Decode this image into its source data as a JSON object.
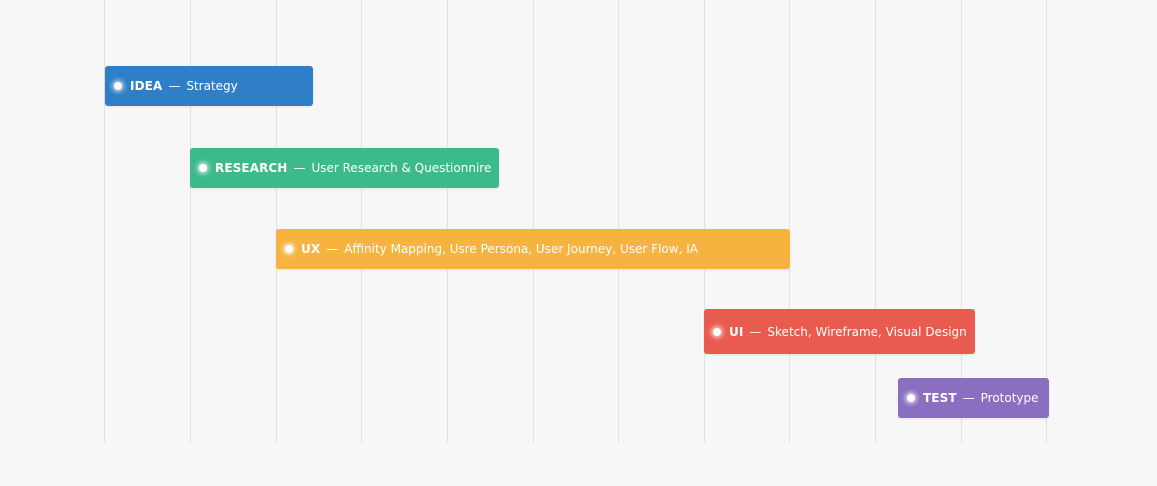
{
  "colors": {
    "background": "#f7f7f7",
    "grid": "#e1e1e1",
    "idea": "#2f7fc8",
    "research": "#3dba8c",
    "ux": "#f6b340",
    "ui": "#e95b4f",
    "test": "#8a6fc0"
  },
  "tasks": [
    {
      "phase": "IDEA",
      "separator": "—",
      "description": "Strategy",
      "color": "#2f7fc8"
    },
    {
      "phase": "RESEARCH",
      "separator": "—",
      "description": "User Research & Questionnire",
      "color": "#3dba8c"
    },
    {
      "phase": "UX",
      "separator": "—",
      "description": "Affinity Mapping, Usre Persona, User Journey, User Flow, IA",
      "color": "#f6b340"
    },
    {
      "phase": "UI",
      "separator": "—",
      "description": "Sketch, Wireframe, Visual Design",
      "color": "#e95b4f"
    },
    {
      "phase": "TEST",
      "separator": "—",
      "description": "Prototype",
      "color": "#8a6fc0"
    }
  ]
}
